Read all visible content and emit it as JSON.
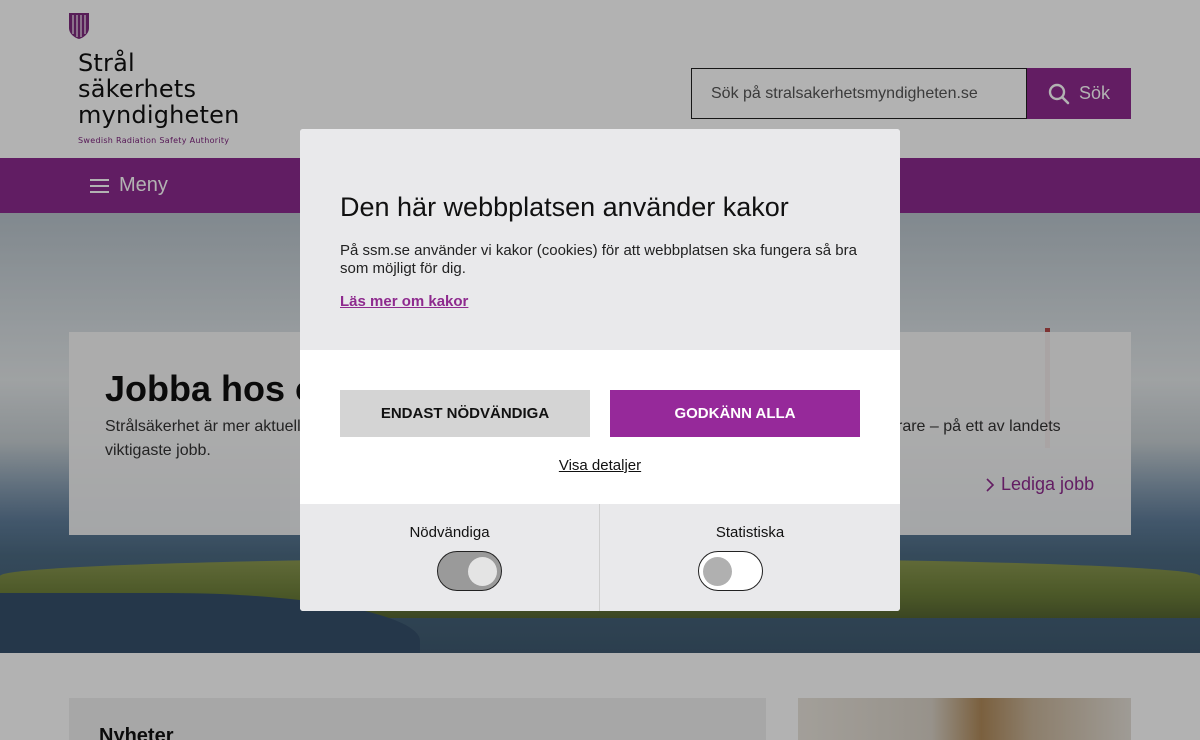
{
  "header": {
    "logo": {
      "line1": "Strål",
      "line2": "säkerhets",
      "line3": "myndigheten",
      "subtitle": "Swedish Radiation Safety Authority"
    },
    "search": {
      "placeholder": "Sök på stralsakerhetsmyndigheten.se",
      "button_label": "Sök"
    }
  },
  "nav": {
    "menu_label": "Meny"
  },
  "hero": {
    "title": "Jobba hos o",
    "text_line1_left": "Strålsäkerhet är mer aktuell",
    "text_line1_right": "krare – på ett av landets",
    "text_line2": "viktigaste jobb.",
    "link_label": "Lediga jobb"
  },
  "lower": {
    "news_title": "Nyheter"
  },
  "cookie_dialog": {
    "title": "Den här webbplatsen använder kakor",
    "body": "På ssm.se använder vi kakor (cookies) för att webbplatsen ska fungera så bra som möjligt för dig.",
    "read_more_link": "Läs mer om kakor",
    "btn_necessary": "ENDAST NÖDVÄNDIGA",
    "btn_accept_all": "GODKÄNN ALLA",
    "details_link": "Visa detaljer",
    "toggles": [
      {
        "label": "Nödvändiga",
        "state": "on"
      },
      {
        "label": "Statistiska",
        "state": "off"
      }
    ]
  },
  "colors": {
    "brand_purple": "#8b2a8e",
    "accept_button": "#96299a",
    "dialog_bg": "#e9e9eb"
  }
}
